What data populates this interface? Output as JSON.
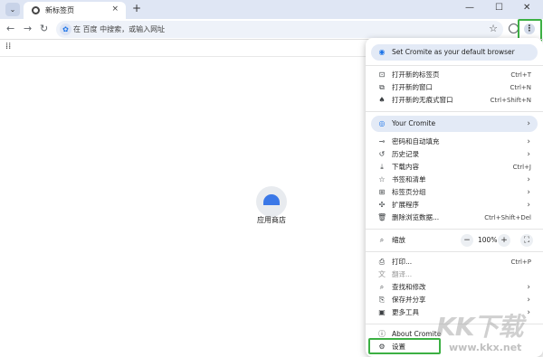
{
  "tab": {
    "title": "新标签页",
    "close": "×",
    "search_icon": "⌄",
    "new_tab": "+"
  },
  "window_controls": {
    "minimize": "—",
    "maximize": "☐",
    "close": "✕"
  },
  "toolbar": {
    "back": "←",
    "forward": "→",
    "reload": "↻",
    "omnibox_placeholder": "在 百度 中搜索，或输入网址",
    "star": "☆",
    "menu": "⋮"
  },
  "apps_icon": "⁞⁞",
  "shortcut": {
    "label": "应用商店"
  },
  "menu": {
    "default_browser": "Set Cromite as your default browser",
    "items_group1": [
      {
        "name": "new-tab",
        "label": "打开新的标签页",
        "shortcut": "Ctrl+T",
        "icon": "⊡"
      },
      {
        "name": "new-window",
        "label": "打开新的窗口",
        "shortcut": "Ctrl+N",
        "icon": "⧉"
      },
      {
        "name": "incognito",
        "label": "打开新的无痕式窗口",
        "shortcut": "Ctrl+Shift+N",
        "icon": "♠"
      }
    ],
    "profile": {
      "label": "Your Cromite",
      "arrow": "›"
    },
    "items_group2": [
      {
        "name": "passwords",
        "label": "密码和自动填充",
        "shortcut": "",
        "arrow": "›",
        "icon": "⊸"
      },
      {
        "name": "history",
        "label": "历史记录",
        "shortcut": "",
        "arrow": "›",
        "icon": "↺"
      },
      {
        "name": "downloads",
        "label": "下载内容",
        "shortcut": "Ctrl+J",
        "arrow": "",
        "icon": "⤓"
      },
      {
        "name": "bookmarks",
        "label": "书签和清单",
        "shortcut": "",
        "arrow": "›",
        "icon": "☆"
      },
      {
        "name": "tab-groups",
        "label": "标签页分组",
        "shortcut": "",
        "arrow": "›",
        "icon": "⊞"
      },
      {
        "name": "extensions",
        "label": "扩展程序",
        "shortcut": "",
        "arrow": "›",
        "icon": "✣"
      },
      {
        "name": "clear-data",
        "label": "删除浏览数据...",
        "shortcut": "Ctrl+Shift+Del",
        "arrow": "",
        "icon": "🗑"
      }
    ],
    "zoom": {
      "label": "缩放",
      "minus": "−",
      "value": "100%",
      "plus": "+",
      "fullscreen": "⛶",
      "icon": "⌕"
    },
    "items_group3": [
      {
        "name": "print",
        "label": "打印...",
        "shortcut": "Ctrl+P",
        "arrow": "",
        "icon": "⎙"
      },
      {
        "name": "translate",
        "label": "翻译...",
        "shortcut": "",
        "arrow": "",
        "icon": "文"
      },
      {
        "name": "find-edit",
        "label": "查找和修改",
        "shortcut": "",
        "arrow": "›",
        "icon": "⌕"
      },
      {
        "name": "save-share",
        "label": "保存并分享",
        "shortcut": "",
        "arrow": "›",
        "icon": "⎘"
      },
      {
        "name": "more-tools",
        "label": "更多工具",
        "shortcut": "",
        "arrow": "›",
        "icon": "▣"
      }
    ],
    "about": {
      "label": "About Cromite",
      "icon": "ⓘ"
    },
    "settings": {
      "label": "设置",
      "icon": "⚙"
    }
  },
  "watermark": {
    "logo": "KK下载",
    "url": "www.kkx.net"
  },
  "colors": {
    "highlight": "#3cb043",
    "accent": "#1a73e8",
    "tabstrip": "#dfe6f4"
  }
}
